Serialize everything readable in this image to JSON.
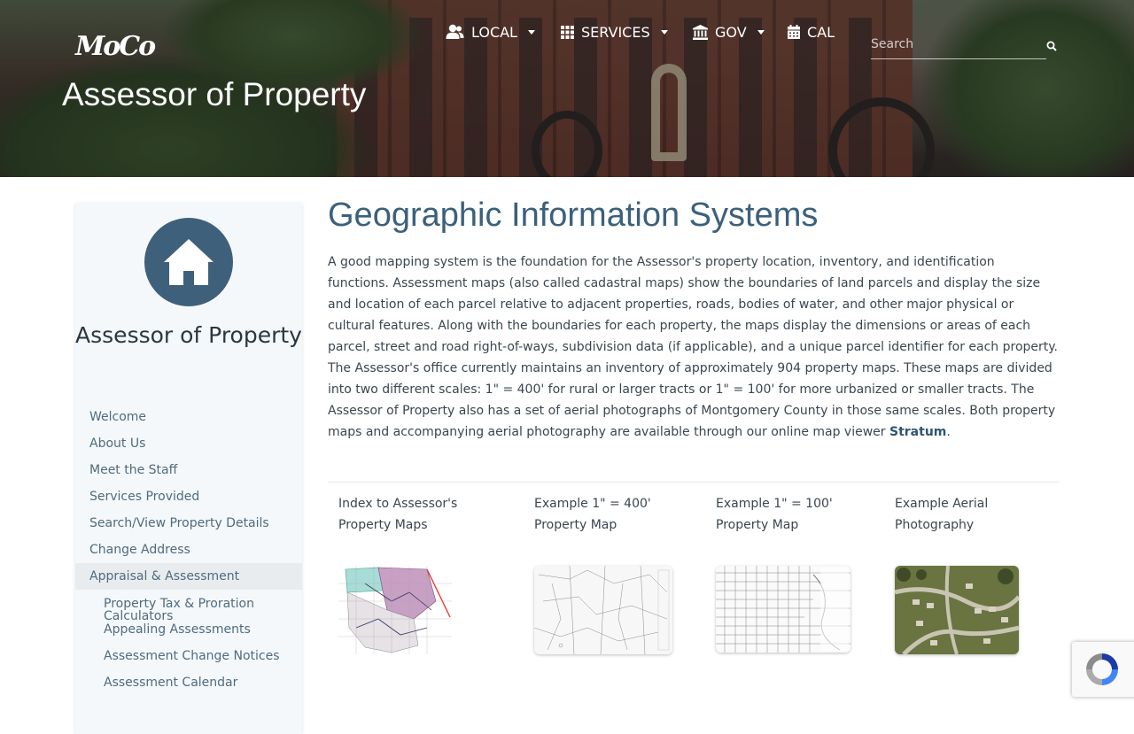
{
  "header": {
    "logo_text": "MoCo",
    "page_title": "Assessor of Property",
    "nav": [
      {
        "label": "LOCAL",
        "icon": "users-icon",
        "has_dropdown": true
      },
      {
        "label": "SERVICES",
        "icon": "grid-icon",
        "has_dropdown": true
      },
      {
        "label": "GOV",
        "icon": "bank-icon",
        "has_dropdown": true
      },
      {
        "label": "CAL",
        "icon": "calendar-icon",
        "has_dropdown": false
      }
    ],
    "search": {
      "placeholder": "Search",
      "value": ""
    }
  },
  "sidebar": {
    "title": "Assessor of Property",
    "icon": "home-icon",
    "items": [
      {
        "label": "Welcome"
      },
      {
        "label": "About Us"
      },
      {
        "label": "Meet the Staff"
      },
      {
        "label": "Services Provided"
      },
      {
        "label": "Search/View Property Details"
      },
      {
        "label": "Change Address"
      },
      {
        "label": "Appraisal & Assessment",
        "active": true
      },
      {
        "label": "Property Tax & Proration Calculators",
        "sub": true
      },
      {
        "label": "Appealing Assessments",
        "sub": true
      },
      {
        "label": "Assessment Change Notices",
        "sub": true
      },
      {
        "label": "Assessment Calendar",
        "sub": true
      }
    ]
  },
  "main": {
    "title": "Geographic Information Systems",
    "body": "A good mapping system is the foundation for the Assessor's property location, inventory, and identification functions. Assessment maps (also called cadastral maps) show the boundaries of land parcels and display the size and location of each parcel relative to adjacent properties, roads, bodies of water, and other major physical or cultural features. Along with the boundaries for each property, the maps display the dimensions or areas of each parcel, street and road right-of-ways, subdivision data (if applicable), and a unique parcel identifier for each property. The Assessor's office currently maintains an inventory of approximately 904 property maps. These maps are divided into two different scales: 1\" = 400' for rural or larger tracts or 1\" = 100' for more urbanized or smaller tracts. The Assessor of Property also has a set of aerial photographs of Montgomery County in those same scales. Both property maps and accompanying aerial photography are available through our online map viewer ",
    "link_label": "Stratum",
    "body_end": ".",
    "maps": [
      {
        "caption_line1": "Index to Assessor's",
        "caption_line2": "Property Maps"
      },
      {
        "caption_line1": "Example 1\" = 400'",
        "caption_line2": "Property Map"
      },
      {
        "caption_line1": "Example 1\" = 100'",
        "caption_line2": "Property Map"
      },
      {
        "caption_line1": "Example Aerial",
        "caption_line2": "Photography"
      }
    ]
  },
  "colors": {
    "accent": "#3b607b",
    "sidebar_icon_bg": "#3f607a",
    "link": "#4e6b80"
  }
}
